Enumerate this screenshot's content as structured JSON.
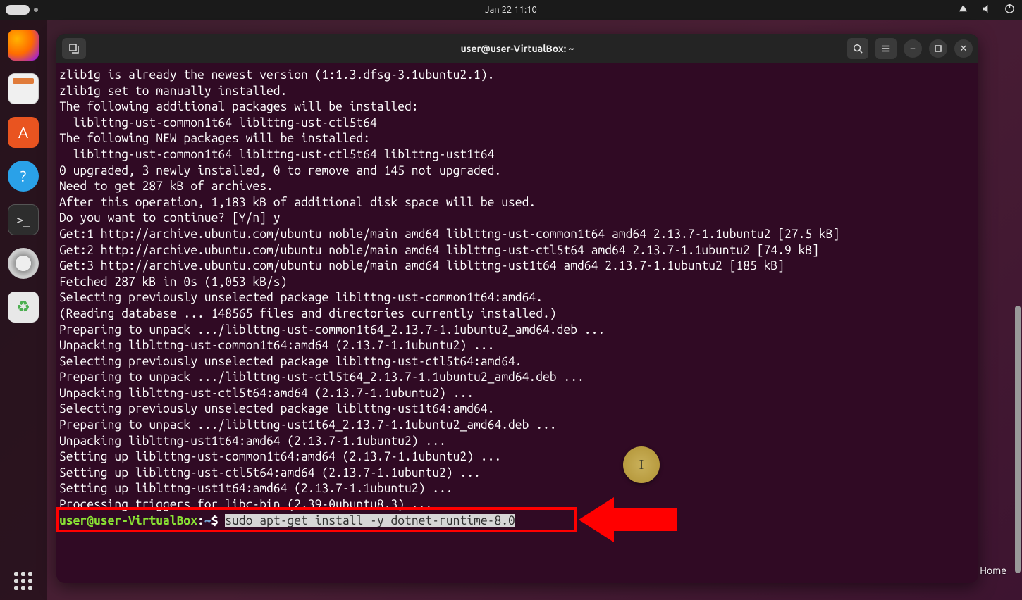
{
  "topbar": {
    "datetime": "Jan 22  11:10"
  },
  "window": {
    "title": "user@user-VirtualBox: ~"
  },
  "terminal": {
    "lines": [
      "zlib1g is already the newest version (1:1.3.dfsg-3.1ubuntu2.1).",
      "zlib1g set to manually installed.",
      "The following additional packages will be installed:",
      "  liblttng-ust-common1t64 liblttng-ust-ctl5t64",
      "The following NEW packages will be installed:",
      "  liblttng-ust-common1t64 liblttng-ust-ctl5t64 liblttng-ust1t64",
      "0 upgraded, 3 newly installed, 0 to remove and 145 not upgraded.",
      "Need to get 287 kB of archives.",
      "After this operation, 1,183 kB of additional disk space will be used.",
      "Do you want to continue? [Y/n] y",
      "Get:1 http://archive.ubuntu.com/ubuntu noble/main amd64 liblttng-ust-common1t64 amd64 2.13.7-1.1ubuntu2 [27.5 kB]",
      "Get:2 http://archive.ubuntu.com/ubuntu noble/main amd64 liblttng-ust-ctl5t64 amd64 2.13.7-1.1ubuntu2 [74.9 kB]",
      "Get:3 http://archive.ubuntu.com/ubuntu noble/main amd64 liblttng-ust1t64 amd64 2.13.7-1.1ubuntu2 [185 kB]",
      "Fetched 287 kB in 0s (1,053 kB/s)",
      "Selecting previously unselected package liblttng-ust-common1t64:amd64.",
      "(Reading database ... 148565 files and directories currently installed.)",
      "Preparing to unpack .../liblttng-ust-common1t64_2.13.7-1.1ubuntu2_amd64.deb ...",
      "Unpacking liblttng-ust-common1t64:amd64 (2.13.7-1.1ubuntu2) ...",
      "Selecting previously unselected package liblttng-ust-ctl5t64:amd64.",
      "Preparing to unpack .../liblttng-ust-ctl5t64_2.13.7-1.1ubuntu2_amd64.deb ...",
      "Unpacking liblttng-ust-ctl5t64:amd64 (2.13.7-1.1ubuntu2) ...",
      "Selecting previously unselected package liblttng-ust1t64:amd64.",
      "Preparing to unpack .../liblttng-ust1t64_2.13.7-1.1ubuntu2_amd64.deb ...",
      "Unpacking liblttng-ust1t64:amd64 (2.13.7-1.1ubuntu2) ...",
      "Setting up liblttng-ust-common1t64:amd64 (2.13.7-1.1ubuntu2) ...",
      "Setting up liblttng-ust-ctl5t64:amd64 (2.13.7-1.1ubuntu2) ...",
      "Setting up liblttng-ust1t64:amd64 (2.13.7-1.1ubuntu2) ...",
      "Processing triggers for libc-bin (2.39-0ubuntu8.3) ..."
    ],
    "prompt_user": "user@user-VirtualBox",
    "prompt_path": "~",
    "prompt_symbol": "$",
    "command": "sudo apt-get install -y dotnet-runtime-8.0"
  },
  "desktop": {
    "home_label": "Home"
  },
  "cursor_glyph": "I"
}
